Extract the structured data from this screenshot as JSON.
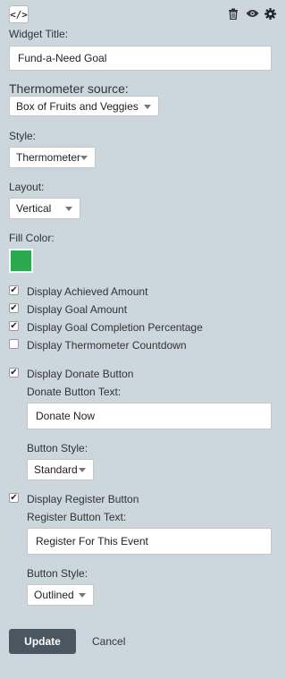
{
  "toolbar": {
    "code_icon": "</>",
    "trash_icon": "trash-icon",
    "eye_icon": "eye-icon",
    "gear_icon": "gear-icon"
  },
  "widget_title": {
    "label": "Widget Title:",
    "value": "Fund-a-Need Goal"
  },
  "thermometer_source": {
    "label": "Thermometer source:",
    "value": "Box of Fruits and Veggies"
  },
  "style": {
    "label": "Style:",
    "value": "Thermometer"
  },
  "layout": {
    "label": "Layout:",
    "value": "Vertical"
  },
  "fill_color": {
    "label": "Fill Color:",
    "color": "#2aa94f"
  },
  "options": [
    {
      "label": "Display Achieved Amount",
      "checked": true
    },
    {
      "label": "Display Goal Amount",
      "checked": true
    },
    {
      "label": "Display Goal Completion Percentage",
      "checked": true
    },
    {
      "label": "Display Thermometer Countdown",
      "checked": false
    }
  ],
  "donate": {
    "toggle_label": "Display Donate Button",
    "checked": true,
    "text_label": "Donate Button Text:",
    "text_value": "Donate Now",
    "style_label": "Button Style:",
    "style_value": "Standard"
  },
  "register": {
    "toggle_label": "Display Register Button",
    "checked": true,
    "text_label": "Register Button Text:",
    "text_value": "Register For This Event",
    "style_label": "Button Style:",
    "style_value": "Outlined"
  },
  "actions": {
    "update": "Update",
    "cancel": "Cancel"
  }
}
